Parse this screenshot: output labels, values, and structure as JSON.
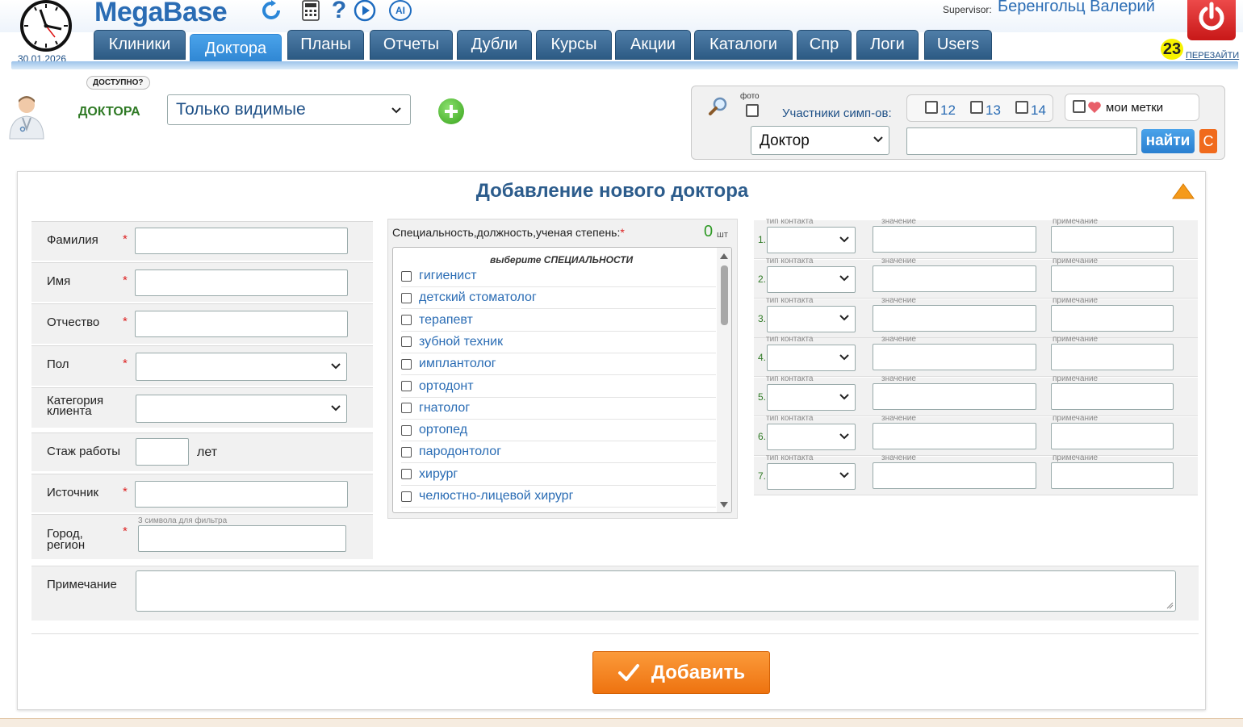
{
  "header": {
    "date": "30.01.2026",
    "logo": "MegaBase",
    "icons": [
      "refresh-icon",
      "calculator-icon",
      "help-icon",
      "play-icon",
      "ai-icon"
    ],
    "ai_label": "AI",
    "help_label": "?",
    "tabs": [
      {
        "label": "Клиники"
      },
      {
        "label": "Доктора",
        "active": true
      },
      {
        "label": "Планы"
      },
      {
        "label": "Отчеты"
      },
      {
        "label": "Дубли"
      },
      {
        "label": "Курсы"
      },
      {
        "label": "Акции"
      },
      {
        "label": "Каталоги"
      },
      {
        "label": "Спр"
      },
      {
        "label": "Логи"
      },
      {
        "label": "Users"
      }
    ],
    "supervisor_label": "Supervisor:",
    "supervisor_name": "Беренгольц Валерий",
    "counter": "23",
    "relogin": "ПЕРЕЗАЙТИ"
  },
  "filter": {
    "available_badge": "ДОСТУПНО?",
    "section_label": "ДОКТОРА",
    "visibility_value": "Только видимые"
  },
  "search": {
    "photo_label": "фото",
    "participants_label": "Участники симп-ов:",
    "years": [
      "12",
      "13",
      "14"
    ],
    "my_tags_label": "мои метки",
    "type_value": "Доктор",
    "find_button": "найти",
    "clear_button": "С"
  },
  "form": {
    "title": "Добавление нового доктора",
    "fields": {
      "last_name": "Фамилия",
      "first_name": "Имя",
      "middle_name": "Отчество",
      "gender": "Пол",
      "category_line1": "Категория",
      "category_line2": "клиента",
      "experience": "Стаж работы",
      "experience_unit": "лет",
      "source": "Источник",
      "city_line1": "Город,",
      "city_line2": "регион",
      "city_hint": "3 символа для фильтра",
      "note": "Примечание"
    },
    "required_mark": "*",
    "specialty": {
      "label": "Специальность,должность,ученая степень:",
      "count": "0",
      "count_unit": "шт",
      "list_header": "выберите СПЕЦИАЛЬНОСТИ",
      "items": [
        "гигиенист",
        "детский стоматолог",
        "терапевт",
        "зубной техник",
        "имплантолог",
        "ортодонт",
        "гнатолог",
        "ортопед",
        "пародонтолог",
        "хирург",
        "челюстно-лицевой хирург"
      ]
    },
    "contacts": {
      "type_label": "тип контакта",
      "value_label": "значение",
      "note_label": "примечание",
      "rows": [
        "1.",
        "2.",
        "3.",
        "4.",
        "5.",
        "6.",
        "7."
      ]
    },
    "submit_button": "Добавить"
  }
}
